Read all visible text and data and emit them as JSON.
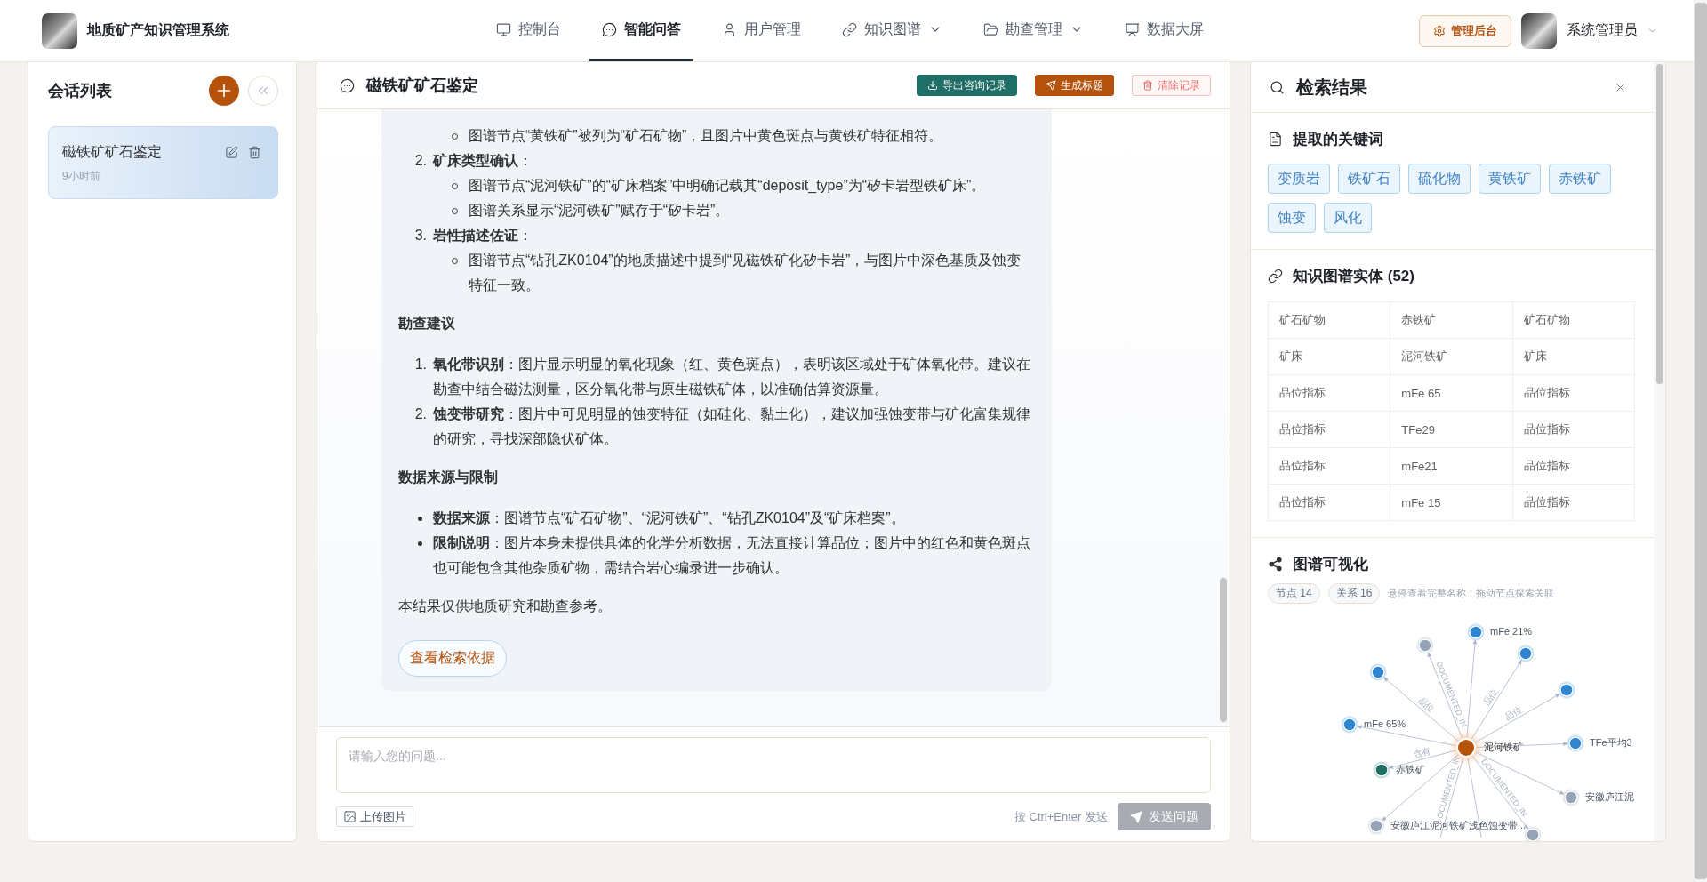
{
  "header": {
    "title": "地质矿产知识管理系统",
    "nav": [
      {
        "label": "控制台",
        "kind": "link",
        "selected": false
      },
      {
        "label": "智能问答",
        "kind": "link",
        "selected": true
      },
      {
        "label": "用户管理",
        "kind": "link",
        "selected": false
      },
      {
        "label": "知识图谱",
        "kind": "menu",
        "selected": false
      },
      {
        "label": "勘查管理",
        "kind": "menu",
        "selected": false
      },
      {
        "label": "数据大屏",
        "kind": "link",
        "selected": false
      }
    ],
    "admin_button": "管理后台",
    "user_name": "系统管理员"
  },
  "sidebar": {
    "title": "会话列表",
    "sessions": [
      {
        "title": "磁铁矿矿石鉴定",
        "time": "9小时前",
        "selected": true
      }
    ]
  },
  "chat": {
    "title": "磁铁矿矿石鉴定",
    "actions": [
      {
        "label": "导出咨询记录",
        "kind": "export"
      },
      {
        "label": "生成标题",
        "kind": "generate"
      },
      {
        "label": "清除记录",
        "kind": "clear"
      }
    ],
    "message": {
      "blocks": [
        {
          "kind": "ordered",
          "items": [
            {
              "children": [
                "图谱节点“黄铁矿”被列为“矿石矿物”，且图片中黄色斑点与黄铁矿特征相符。"
              ]
            },
            {
              "number": "2.",
              "text": "**矿床类型确认**：",
              "children": [
                "图谱节点“泥河铁矿”的“矿床档案”中明确记载其“deposit_type”为“矽卡岩型铁矿床”。",
                "图谱关系显示“泥河铁矿”赋存于“矽卡岩”。"
              ]
            },
            {
              "number": "3.",
              "text": "**岩性描述佐证**：",
              "children": [
                "图谱节点“钻孔ZK0104”的地质描述中提到“见磁铁矿化矽卡岩”，与图片中深色基质及蚀变特征一致。"
              ]
            }
          ]
        },
        {
          "kind": "heading",
          "text": "勘查建议"
        },
        {
          "kind": "ordered",
          "items": [
            {
              "number": "1.",
              "text": "**氧化带识别**：图片显示明显的氧化现象（红、黄色斑点），表明该区域处于矿体氧化带。建议在勘查中结合磁法测量，区分氧化带与原生磁铁矿体，以准确估算资源量。"
            },
            {
              "number": "2.",
              "text": "**蚀变带研究**：图片中可见明显的蚀变特征（如硅化、黏土化），建议加强蚀变带与矿化富集规律的研究，寻找深部隐伏矿体。"
            }
          ]
        },
        {
          "kind": "heading",
          "text": "数据来源与限制"
        },
        {
          "kind": "bullets",
          "items": [
            {
              "text": "**数据来源**：图谱节点“矿石矿物”、“泥河铁矿”、“钻孔ZK0104”及“矿床档案”。"
            },
            {
              "text": "**限制说明**：图片本身未提供具体的化学分析数据，无法直接计算品位；图片中的红色和黄色斑点也可能包含其他杂质矿物，需结合岩心编录进一步确认。"
            }
          ]
        },
        {
          "kind": "paragraph",
          "text": "本结果仅供地质研究和勘查参考。"
        }
      ],
      "button": "查看检索依据"
    },
    "input": {
      "placeholder": "请输入您的问题...",
      "upload_button": "上传图片",
      "hint": "按 Ctrl+Enter 发送",
      "send_button": {
        "label": "发送问题",
        "disabled": true
      }
    }
  },
  "results": {
    "title": "检索结果",
    "keywords": {
      "title": "提取的关键词",
      "items": [
        "变质岩",
        "铁矿石",
        "硫化物",
        "黄铁矿",
        "赤铁矿",
        "蚀变",
        "风化"
      ]
    },
    "entities": {
      "title": "知识图谱实体 (52)",
      "rows": [
        [
          "矿石矿物",
          "赤铁矿",
          "矿石矿物"
        ],
        [
          "矿床",
          "泥河铁矿",
          "矿床"
        ],
        [
          "品位指标",
          "mFe 65",
          "品位指标"
        ],
        [
          "品位指标",
          "TFe29",
          "品位指标"
        ],
        [
          "品位指标",
          "mFe21",
          "品位指标"
        ],
        [
          "品位指标",
          "mFe 15",
          "品位指标"
        ]
      ]
    },
    "graph": {
      "title": "图谱可视化",
      "stats": [
        "节点 14",
        "关系 16"
      ],
      "hint": "悬停查看完整名称，拖动节点探索关联",
      "center": {
        "label": "泥河铁矿",
        "color": "#b5520c"
      },
      "nodes": [
        {
          "kind": "node",
          "label": "mFe 21%",
          "color": "#2e86d1"
        },
        {
          "kind": "node",
          "color": "#94a3b8",
          "edge_label": "DOCUMENTED_IN"
        },
        {
          "kind": "node",
          "color": "#2e86d1",
          "edge_label": "品位"
        },
        {
          "kind": "node",
          "color": "#2e86d1",
          "edge_label": "品位"
        },
        {
          "kind": "node",
          "color": "#2e86d1",
          "edge_label": "品位"
        },
        {
          "kind": "node",
          "label": "mFe 65%",
          "color": "#2e86d1"
        },
        {
          "kind": "node",
          "label": "TFe平均3",
          "color": "#2e86d1"
        },
        {
          "kind": "node",
          "label": "赤铁矿",
          "color": "#1f6f66",
          "edge_label": "含有"
        },
        {
          "kind": "node",
          "label": "安徽庐江泥",
          "color": "#94a3b8"
        },
        {
          "kind": "node",
          "label": "安徽庐江泥河铁矿浅色蚀变带...",
          "color": "#94a3b8"
        },
        {
          "kind": "node",
          "color": "#94a3b8",
          "edge_label": "DOCUMENTED_IN"
        },
        {
          "kind": "stub",
          "edge_label": "OCUMENTED_IN"
        },
        {
          "kind": "stub"
        }
      ]
    }
  }
}
